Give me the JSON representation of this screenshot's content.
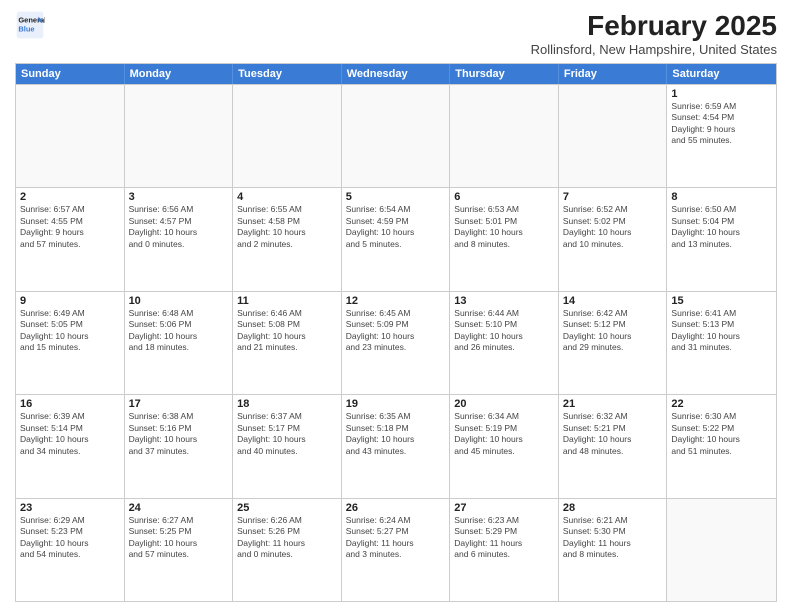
{
  "header": {
    "logo_line1": "General",
    "logo_line2": "Blue",
    "month_title": "February 2025",
    "location": "Rollinsford, New Hampshire, United States"
  },
  "days_of_week": [
    "Sunday",
    "Monday",
    "Tuesday",
    "Wednesday",
    "Thursday",
    "Friday",
    "Saturday"
  ],
  "rows": [
    [
      {
        "day": "",
        "info": ""
      },
      {
        "day": "",
        "info": ""
      },
      {
        "day": "",
        "info": ""
      },
      {
        "day": "",
        "info": ""
      },
      {
        "day": "",
        "info": ""
      },
      {
        "day": "",
        "info": ""
      },
      {
        "day": "1",
        "info": "Sunrise: 6:59 AM\nSunset: 4:54 PM\nDaylight: 9 hours\nand 55 minutes."
      }
    ],
    [
      {
        "day": "2",
        "info": "Sunrise: 6:57 AM\nSunset: 4:55 PM\nDaylight: 9 hours\nand 57 minutes."
      },
      {
        "day": "3",
        "info": "Sunrise: 6:56 AM\nSunset: 4:57 PM\nDaylight: 10 hours\nand 0 minutes."
      },
      {
        "day": "4",
        "info": "Sunrise: 6:55 AM\nSunset: 4:58 PM\nDaylight: 10 hours\nand 2 minutes."
      },
      {
        "day": "5",
        "info": "Sunrise: 6:54 AM\nSunset: 4:59 PM\nDaylight: 10 hours\nand 5 minutes."
      },
      {
        "day": "6",
        "info": "Sunrise: 6:53 AM\nSunset: 5:01 PM\nDaylight: 10 hours\nand 8 minutes."
      },
      {
        "day": "7",
        "info": "Sunrise: 6:52 AM\nSunset: 5:02 PM\nDaylight: 10 hours\nand 10 minutes."
      },
      {
        "day": "8",
        "info": "Sunrise: 6:50 AM\nSunset: 5:04 PM\nDaylight: 10 hours\nand 13 minutes."
      }
    ],
    [
      {
        "day": "9",
        "info": "Sunrise: 6:49 AM\nSunset: 5:05 PM\nDaylight: 10 hours\nand 15 minutes."
      },
      {
        "day": "10",
        "info": "Sunrise: 6:48 AM\nSunset: 5:06 PM\nDaylight: 10 hours\nand 18 minutes."
      },
      {
        "day": "11",
        "info": "Sunrise: 6:46 AM\nSunset: 5:08 PM\nDaylight: 10 hours\nand 21 minutes."
      },
      {
        "day": "12",
        "info": "Sunrise: 6:45 AM\nSunset: 5:09 PM\nDaylight: 10 hours\nand 23 minutes."
      },
      {
        "day": "13",
        "info": "Sunrise: 6:44 AM\nSunset: 5:10 PM\nDaylight: 10 hours\nand 26 minutes."
      },
      {
        "day": "14",
        "info": "Sunrise: 6:42 AM\nSunset: 5:12 PM\nDaylight: 10 hours\nand 29 minutes."
      },
      {
        "day": "15",
        "info": "Sunrise: 6:41 AM\nSunset: 5:13 PM\nDaylight: 10 hours\nand 31 minutes."
      }
    ],
    [
      {
        "day": "16",
        "info": "Sunrise: 6:39 AM\nSunset: 5:14 PM\nDaylight: 10 hours\nand 34 minutes."
      },
      {
        "day": "17",
        "info": "Sunrise: 6:38 AM\nSunset: 5:16 PM\nDaylight: 10 hours\nand 37 minutes."
      },
      {
        "day": "18",
        "info": "Sunrise: 6:37 AM\nSunset: 5:17 PM\nDaylight: 10 hours\nand 40 minutes."
      },
      {
        "day": "19",
        "info": "Sunrise: 6:35 AM\nSunset: 5:18 PM\nDaylight: 10 hours\nand 43 minutes."
      },
      {
        "day": "20",
        "info": "Sunrise: 6:34 AM\nSunset: 5:19 PM\nDaylight: 10 hours\nand 45 minutes."
      },
      {
        "day": "21",
        "info": "Sunrise: 6:32 AM\nSunset: 5:21 PM\nDaylight: 10 hours\nand 48 minutes."
      },
      {
        "day": "22",
        "info": "Sunrise: 6:30 AM\nSunset: 5:22 PM\nDaylight: 10 hours\nand 51 minutes."
      }
    ],
    [
      {
        "day": "23",
        "info": "Sunrise: 6:29 AM\nSunset: 5:23 PM\nDaylight: 10 hours\nand 54 minutes."
      },
      {
        "day": "24",
        "info": "Sunrise: 6:27 AM\nSunset: 5:25 PM\nDaylight: 10 hours\nand 57 minutes."
      },
      {
        "day": "25",
        "info": "Sunrise: 6:26 AM\nSunset: 5:26 PM\nDaylight: 11 hours\nand 0 minutes."
      },
      {
        "day": "26",
        "info": "Sunrise: 6:24 AM\nSunset: 5:27 PM\nDaylight: 11 hours\nand 3 minutes."
      },
      {
        "day": "27",
        "info": "Sunrise: 6:23 AM\nSunset: 5:29 PM\nDaylight: 11 hours\nand 6 minutes."
      },
      {
        "day": "28",
        "info": "Sunrise: 6:21 AM\nSunset: 5:30 PM\nDaylight: 11 hours\nand 8 minutes."
      },
      {
        "day": "",
        "info": ""
      }
    ]
  ]
}
